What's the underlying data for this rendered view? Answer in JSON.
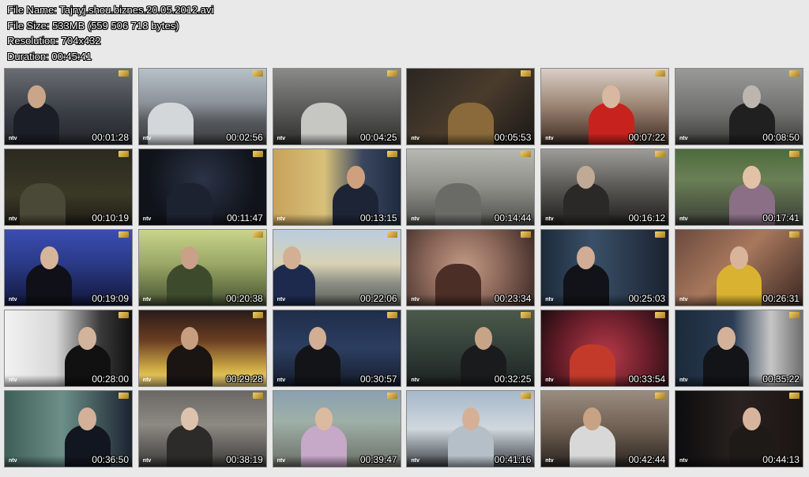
{
  "header": {
    "file_name": "File Name: Tajnyj.shou.biznes.20.05.2012.avi",
    "file_size": "File Size: 533MB (559 506 718 bytes)",
    "resolution": "Resolution: 704x432",
    "duration": "Duration: 00:45:41"
  },
  "thumbnails": [
    {
      "time": "00:01:28",
      "bg": "linear-gradient(180deg,#6a6d72 0%,#3b3f46 55%,#23262b 100%)",
      "fig": "#1b1e26",
      "face": "#c9a58a",
      "fx": 25
    },
    {
      "time": "00:02:56",
      "bg": "linear-gradient(180deg,#b7c2c8 0%,#8b9299 45%,#55585c 70%,#3c3d3f 100%)",
      "fig": "#d4d7da",
      "face": "",
      "fx": 25
    },
    {
      "time": "00:04:25",
      "bg": "linear-gradient(180deg,#8a8a88 0%,#5d5d5b 50%,#2e2e2d 100%)",
      "fig": "#c6c6c2",
      "face": "",
      "fx": 40
    },
    {
      "time": "00:05:53",
      "bg": "linear-gradient(135deg,#2a2622 0%,#4a3c2c 50%,#1a1816 100%)",
      "fig": "#8a6a3a",
      "face": "",
      "fx": 50
    },
    {
      "time": "00:07:22",
      "bg": "linear-gradient(180deg,#d9cfc6 0%,#9a8270 50%,#3b2a22 100%)",
      "fig": "#c8221e",
      "face": "#d8b8a0",
      "fx": 55
    },
    {
      "time": "00:08:50",
      "bg": "linear-gradient(180deg,#9a9a98 0%,#6e6e6c 60%,#3a3a39 100%)",
      "fig": "#202020",
      "face": "#bdb6ae",
      "fx": 60
    },
    {
      "time": "00:10:19",
      "bg": "linear-gradient(180deg,#2b2a20 0%,#3a3826 60%,#1d1c15 100%)",
      "fig": "#4a4836",
      "face": "",
      "fx": 30
    },
    {
      "time": "00:11:47",
      "bg": "radial-gradient(circle at 50% 40%,#2b3346 0%,#10131a 70%)",
      "fig": "#1c2230",
      "face": "",
      "fx": 40
    },
    {
      "time": "00:13:15",
      "bg": "linear-gradient(90deg,#c7a25a 0%,#d8c07a 40%,#3b4760 70%,#1e2a3e 100%)",
      "fig": "#1d2436",
      "face": "#cfa07e",
      "fx": 65
    },
    {
      "time": "00:14:44",
      "bg": "linear-gradient(180deg,#b8b8b2 0%,#8d8e88 50%,#4e4f4a 100%)",
      "fig": "#6a6b66",
      "face": "",
      "fx": 40
    },
    {
      "time": "00:16:12",
      "bg": "linear-gradient(180deg,#9e9c98 0%,#5a5854 50%,#1e1d1c 100%)",
      "fig": "#2a2928",
      "face": "#c0aa96",
      "fx": 35
    },
    {
      "time": "00:17:41",
      "bg": "linear-gradient(180deg,#4d6b3c 0%,#6b7f56 40%,#3a3d36 100%)",
      "fig": "#8a6f86",
      "face": "#e2c2a6",
      "fx": 60
    },
    {
      "time": "00:19:09",
      "bg": "linear-gradient(180deg,#3a4db3 0%,#2a3a86 45%,#12173a 100%)",
      "fig": "#0f1018",
      "face": "#d6b59a",
      "fx": 35
    },
    {
      "time": "00:20:38",
      "bg": "linear-gradient(180deg,#c9d58a 0%,#9aa766 45%,#445030 100%)",
      "fig": "#3d4a2c",
      "face": "#caa088",
      "fx": 40
    },
    {
      "time": "00:22:06",
      "bg": "linear-gradient(180deg,#b9cde0 0%,#d8d2b4 45%,#8d8f85 70%,#5c5f5a 100%)",
      "fig": "#1d2a4e",
      "face": "#d3b093",
      "fx": 15
    },
    {
      "time": "00:23:34",
      "bg": "radial-gradient(circle at 45% 50%,#c49a86 0%,#8f6a5c 45%,#3b2925 100%)",
      "fig": "#4b2e26",
      "face": "",
      "fx": 40
    },
    {
      "time": "00:25:03",
      "bg": "linear-gradient(90deg,#1c2a3a 0%,#3a5068 40%,#1a2230 100%)",
      "fig": "#111318",
      "face": "#d0ad94",
      "fx": 35
    },
    {
      "time": "00:26:31",
      "bg": "linear-gradient(135deg,#6b4a3e 0%,#a8785c 45%,#3a2722 100%)",
      "fig": "#d8b230",
      "face": "#d8b59a",
      "fx": 50
    },
    {
      "time": "00:28:00",
      "bg": "linear-gradient(90deg,#f2f2f2 0%,#d8d8d8 40%,#3a3a3a 75%,#101010 100%)",
      "fig": "#111111",
      "face": "#d2b49c",
      "fx": 65
    },
    {
      "time": "00:29:28",
      "bg": "linear-gradient(180deg,#2a1c18 0%,#6b3e22 40%,#d6b44a 80%,#f0d67a 100%)",
      "fig": "#1a1412",
      "face": "#c79e80",
      "fx": 40
    },
    {
      "time": "00:30:57",
      "bg": "linear-gradient(180deg,#1e2e4a 0%,#2c3e60 50%,#141c2c 100%)",
      "fig": "#131418",
      "face": "#d1ae94",
      "fx": 35
    },
    {
      "time": "00:32:25",
      "bg": "linear-gradient(180deg,#4b5a4a 0%,#33403a 50%,#1c2220 100%)",
      "fig": "#1a1b1d",
      "face": "#c7a488",
      "fx": 60
    },
    {
      "time": "00:33:54",
      "bg": "radial-gradient(circle at 50% 60%,#b83a4a 0%,#6a1e2a 55%,#1e0c10 100%)",
      "fig": "#c33a2a",
      "face": "",
      "fx": 40
    },
    {
      "time": "00:35:22",
      "bg": "linear-gradient(90deg,#1c2a3a 0%,#2a3c54 45%,#c6c6c6 75%,#6e6e6e 100%)",
      "fig": "#121418",
      "face": "#d4b29a",
      "fx": 40
    },
    {
      "time": "00:36:50",
      "bg": "linear-gradient(90deg,#3e5f56 0%,#6c8f88 45%,#1b2330 100%)",
      "fig": "#121620",
      "face": "#d2b09a",
      "fx": 65
    },
    {
      "time": "00:38:19",
      "bg": "linear-gradient(180deg,#6a6864 0%,#8d8a84 45%,#3b3a38 100%)",
      "fig": "#2c2b2a",
      "face": "#ddc3ae",
      "fx": 40
    },
    {
      "time": "00:39:47",
      "bg": "linear-gradient(180deg,#8aa0b0 0%,#9fb0a8 40%,#6b6f66 100%)",
      "fig": "#c6a8c8",
      "face": "#dcbaa0",
      "fx": 40
    },
    {
      "time": "00:41:16",
      "bg": "linear-gradient(180deg,#a6b8c8 0%,#d0d8de 50%,#3a3e44 100%)",
      "fig": "#b5bfc8",
      "face": "#d6b096",
      "fx": 50
    },
    {
      "time": "00:42:44",
      "bg": "linear-gradient(180deg,#9a8c7e 0%,#6e5f52 50%,#2a2420 100%)",
      "fig": "#d8d8d8",
      "face": "#c8a284",
      "fx": 40
    },
    {
      "time": "00:44:13",
      "bg": "linear-gradient(90deg,#0c0c0e 0%,#2a2220 50%,#1a1412 100%)",
      "fig": "#1e1a18",
      "face": "#d8b49c",
      "fx": 60
    }
  ],
  "logo_text": "ntv"
}
